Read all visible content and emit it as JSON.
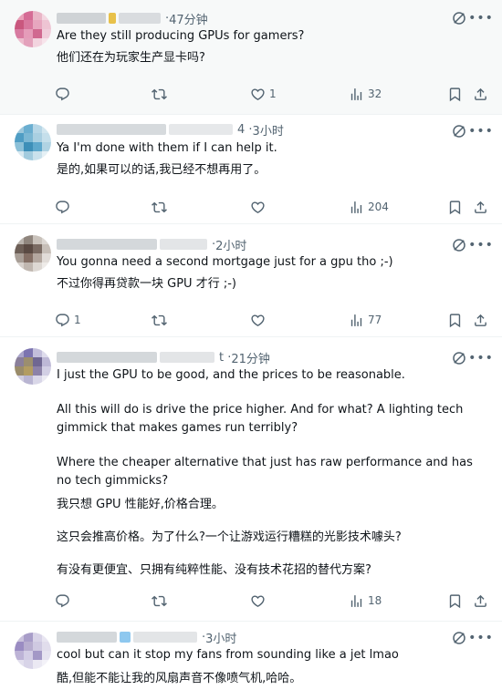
{
  "comments": [
    {
      "time": "47分钟",
      "lines": [
        "Are they still producing GPUs for gamers?",
        "他们还在为玩家生产显卡吗?"
      ],
      "reply_count": "",
      "like_count": "1",
      "view_count": "32"
    },
    {
      "time": "3小时",
      "lines": [
        "Ya I'm done with them if I can help it.",
        "是的,如果可以的话,我已经不想再用了。"
      ],
      "reply_count": "",
      "like_count": "",
      "view_count": "204"
    },
    {
      "time": "2小时",
      "lines": [
        "You gonna need a second mortgage just for a gpu tho ;-)",
        "不过你得再贷款一块 GPU 才行 ;-)"
      ],
      "reply_count": "1",
      "like_count": "",
      "view_count": "77"
    },
    {
      "time": "21分钟",
      "lines": [
        "I just the GPU to be good, and the prices to be reasonable.",
        "All this will do is drive the price higher. And for what? A lighting tech gimmick that makes games run terribly?",
        "Where the cheaper alternative that just has raw performance and has no tech gimmicks?",
        "我只想 GPU 性能好,价格合理。",
        "这只会推高价格。为了什么?一个让游戏运行糟糕的光影技术噱头?",
        "有没有更便宜、只拥有纯粹性能、没有技术花招的替代方案?"
      ],
      "reply_count": "",
      "like_count": "",
      "view_count": "18"
    },
    {
      "time": "3小时",
      "lines": [
        "cool but can it stop my fans from sounding like a jet lmao",
        "酷,但能不能让我的风扇声音不像喷气机,哈哈。"
      ]
    }
  ],
  "colors": {
    "text": "#0f1419",
    "muted": "#536471",
    "divider": "#eff3f4",
    "highlight_bg": "#f7f9f9"
  },
  "icons": [
    "reply-icon",
    "retweet-icon",
    "like-icon",
    "views-icon",
    "bookmark-icon",
    "share-icon",
    "grok-icon",
    "more-icon"
  ]
}
